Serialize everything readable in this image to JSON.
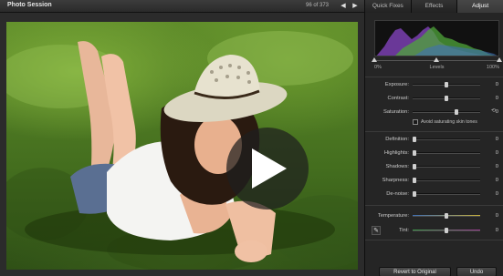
{
  "header": {
    "title": "Photo Session",
    "counter": "96 of 373",
    "prev_icon": "arrow-left-icon",
    "next_icon": "arrow-right-icon"
  },
  "video": {
    "play_icon": "play-icon"
  },
  "panel": {
    "tabs": [
      {
        "label": "Quick Fixes",
        "active": false
      },
      {
        "label": "Effects",
        "active": false
      },
      {
        "label": "Adjust",
        "active": true
      }
    ],
    "levels": {
      "left_label": "0%",
      "center_label": "Levels",
      "right_label": "100%"
    },
    "adjust_group_1": [
      {
        "label": "Exposure:",
        "value": "0",
        "position": 0.5
      },
      {
        "label": "Contrast:",
        "value": "0",
        "position": 0.5
      },
      {
        "label": "Saturation:",
        "value": "0",
        "position": 0.65
      }
    ],
    "avoid_skin_tones": {
      "label": "Avoid saturating skin tones",
      "checked": false
    },
    "adjust_group_2": [
      {
        "label": "Definition:",
        "value": "0",
        "position": 0.0
      },
      {
        "label": "Highlights:",
        "value": "0",
        "position": 0.0
      },
      {
        "label": "Shadows:",
        "value": "0",
        "position": 0.0
      },
      {
        "label": "Sharpness:",
        "value": "0",
        "position": 0.0
      },
      {
        "label": "De-noise:",
        "value": "0",
        "position": 0.0
      }
    ],
    "adjust_group_3": [
      {
        "label": "Temperature:",
        "value": "0",
        "position": 0.5
      },
      {
        "label": "Tint:",
        "value": "0",
        "position": 0.5
      }
    ],
    "eyedropper_icon": "eyedropper-icon",
    "reset_icon": "reset-icon",
    "buttons": {
      "revert": "Revert to Original",
      "undo": "Undo"
    }
  },
  "colors": {
    "panel_bg": "#252525",
    "accent_knob": "#cfcfcf",
    "histogram_purple": "#7a3fb0",
    "histogram_green": "#4fa53a",
    "temperature_blue": "#3f6fb5",
    "temperature_yellow": "#c8b03a",
    "tint_green": "#3c9a48",
    "tint_magenta": "#a03c96"
  }
}
